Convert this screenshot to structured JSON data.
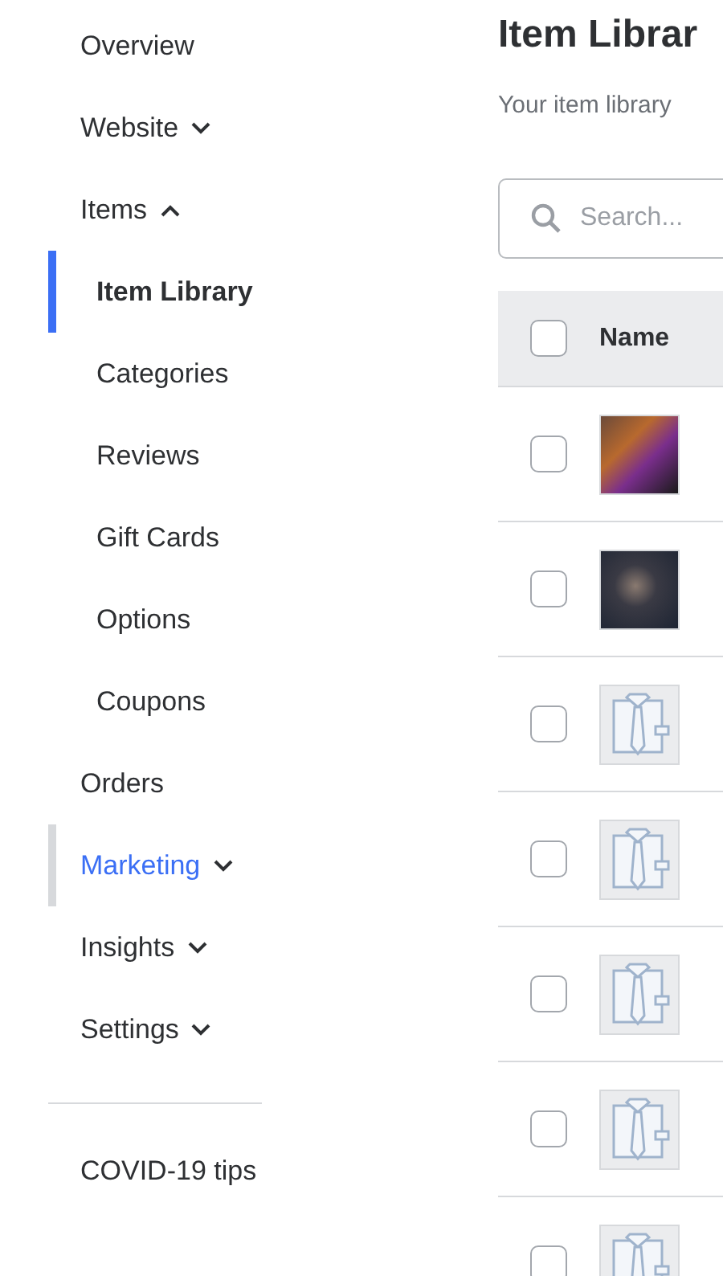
{
  "sidebar": {
    "items": [
      {
        "label": "Overview",
        "selected": false,
        "hovered": false
      },
      {
        "label": "Website",
        "selected": false,
        "hovered": false,
        "expanded": false
      },
      {
        "label": "Items",
        "selected": false,
        "hovered": false,
        "expanded": true,
        "children": [
          {
            "label": "Item Library",
            "selected": true
          },
          {
            "label": "Categories",
            "selected": false
          },
          {
            "label": "Reviews",
            "selected": false
          },
          {
            "label": "Gift Cards",
            "selected": false
          },
          {
            "label": "Options",
            "selected": false
          },
          {
            "label": "Coupons",
            "selected": false
          }
        ]
      },
      {
        "label": "Orders",
        "selected": false,
        "hovered": false
      },
      {
        "label": "Marketing",
        "selected": false,
        "hovered": true,
        "expanded": false
      },
      {
        "label": "Insights",
        "selected": false,
        "hovered": false,
        "expanded": false
      },
      {
        "label": "Settings",
        "selected": false,
        "hovered": false,
        "expanded": false
      }
    ],
    "footer_link": "COVID-19 tips"
  },
  "page": {
    "title": "Item Librar",
    "subtitle": "Your item library",
    "search": {
      "placeholder": "Search..."
    }
  },
  "table": {
    "header_checked": false,
    "columns": [
      "Name"
    ],
    "rows": [
      {
        "checked": false,
        "kind": "photo"
      },
      {
        "checked": false,
        "kind": "photo"
      },
      {
        "checked": false,
        "kind": "placeholder"
      },
      {
        "checked": false,
        "kind": "placeholder"
      },
      {
        "checked": false,
        "kind": "placeholder"
      },
      {
        "checked": false,
        "kind": "placeholder"
      },
      {
        "checked": false,
        "kind": "placeholder"
      }
    ]
  }
}
